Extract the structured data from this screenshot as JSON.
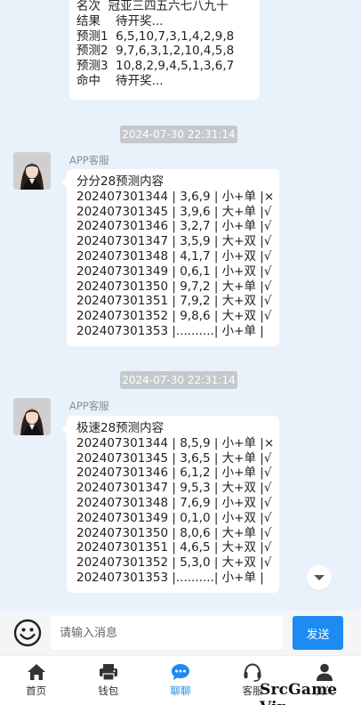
{
  "top_card": {
    "lines": [
      "名次  冠亚三四五六七八九十",
      "结果    待开奖...",
      "预测1  6,5,10,7,3,1,4,2,9,8",
      "预测2  9,7,6,3,1,2,10,4,5,8",
      "预测3  10,8,2,9,4,5,1,3,6,7",
      "命中    待开奖..."
    ]
  },
  "messages": [
    {
      "timestamp": "2024-07-30 22:31:14",
      "sender": "APP客服",
      "title": "分分28预测内容",
      "rows": [
        "202407301344 | 3,6,9 | 小+单 |×",
        "202407301345 | 3,9,6 | 大+单 |√",
        "202407301346 | 3,2,7 | 小+单 |√",
        "202407301347 | 3,5,9 | 大+双 |√",
        "202407301348 | 4,1,7 | 小+双 |√",
        "202407301349 | 0,6,1 | 小+双 |√",
        "202407301350 | 9,7,2 | 大+单 |√",
        "202407301351 | 7,9,2 | 大+双 |√",
        "202407301352 | 9,8,6 | 大+双 |√",
        "202407301353 |..........| 小+单 |"
      ]
    },
    {
      "timestamp": "2024-07-30 22:31:14",
      "sender": "APP客服",
      "title": "极速28预测内容",
      "rows": [
        "202407301344 | 8,5,9 | 小+单 |×",
        "202407301345 | 3,6,5 | 大+单 |√",
        "202407301346 | 6,1,2 | 小+单 |√",
        "202407301347 | 9,5,3 | 大+双 |√",
        "202407301348 | 7,6,9 | 小+双 |√",
        "202407301349 | 0,1,0 | 小+双 |√",
        "202407301350 | 8,0,6 | 大+单 |√",
        "202407301351 | 4,6,5 | 大+双 |√",
        "202407301352 | 5,3,0 | 大+双 |√",
        "202407301353 |..........| 小+单 |"
      ]
    }
  ],
  "input": {
    "placeholder": "请输入消息",
    "send_label": "发送"
  },
  "tabbar": {
    "items": [
      {
        "label": "首页",
        "icon": "home-icon"
      },
      {
        "label": "钱包",
        "icon": "wallet-icon"
      },
      {
        "label": "聊聊",
        "icon": "chat-icon",
        "active": true
      },
      {
        "label": "客服",
        "icon": "headset-icon"
      },
      {
        "label": "我的",
        "icon": "user-icon"
      }
    ]
  },
  "colors": {
    "accent": "#1d8bf1",
    "background": "#e9f2fb",
    "timestamp_bg": "#c5c8cc"
  },
  "watermark": "SrcGame Vip"
}
